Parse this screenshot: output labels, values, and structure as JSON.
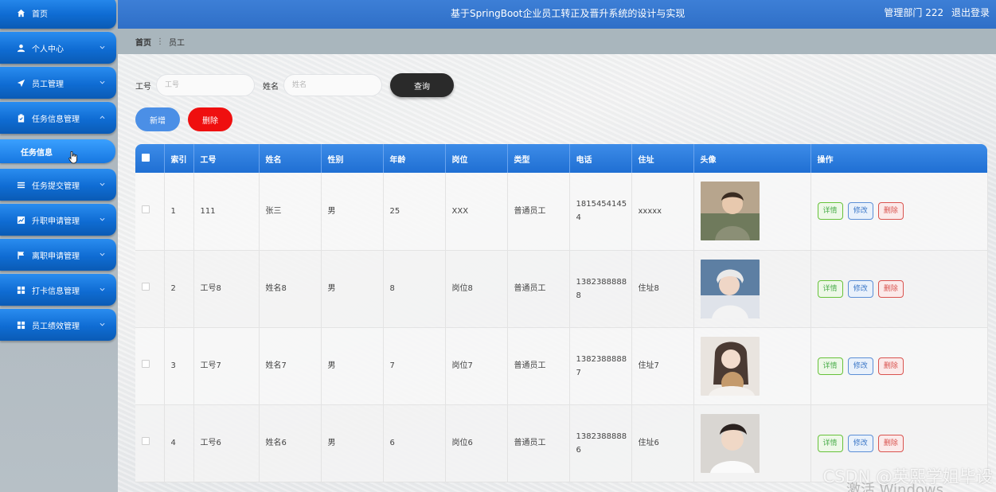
{
  "header": {
    "title": "基于SpringBoot企业员工转正及晋升系统的设计与实现",
    "user_label": "管理部门 222",
    "logout": "退出登录"
  },
  "sidebar": {
    "items": [
      {
        "label": "首页",
        "icon": "home-icon"
      },
      {
        "label": "个人中心",
        "icon": "user-icon"
      },
      {
        "label": "员工管理",
        "icon": "send-icon"
      },
      {
        "label": "任务信息管理",
        "icon": "clipboard-icon"
      },
      {
        "label": "任务提交管理",
        "icon": "list-icon"
      },
      {
        "label": "升职申请管理",
        "icon": "chart-icon"
      },
      {
        "label": "离职申请管理",
        "icon": "flag-icon"
      },
      {
        "label": "打卡信息管理",
        "icon": "grid-icon"
      },
      {
        "label": "员工绩效管理",
        "icon": "grid-icon"
      }
    ],
    "sub_item": "任务信息"
  },
  "breadcrumb": {
    "home": "首页",
    "current": "员工"
  },
  "search": {
    "id_label": "工号",
    "id_placeholder": "工号",
    "name_label": "姓名",
    "name_placeholder": "姓名",
    "query_button": "查询"
  },
  "actions": {
    "add": "新增",
    "delete": "删除"
  },
  "table": {
    "columns": [
      "索引",
      "工号",
      "姓名",
      "性别",
      "年龄",
      "岗位",
      "类型",
      "电话",
      "住址",
      "头像",
      "操作"
    ],
    "rows": [
      {
        "index": "1",
        "id": "111",
        "name": "张三",
        "gender": "男",
        "age": "25",
        "post": "XXX",
        "type": "普通员工",
        "phone": "18154541454",
        "address": "xxxxx"
      },
      {
        "index": "2",
        "id": "工号8",
        "name": "姓名8",
        "gender": "男",
        "age": "8",
        "post": "岗位8",
        "type": "普通员工",
        "phone": "13823888888",
        "address": "住址8"
      },
      {
        "index": "3",
        "id": "工号7",
        "name": "姓名7",
        "gender": "男",
        "age": "7",
        "post": "岗位7",
        "type": "普通员工",
        "phone": "13823888887",
        "address": "住址7"
      },
      {
        "index": "4",
        "id": "工号6",
        "name": "姓名6",
        "gender": "男",
        "age": "6",
        "post": "岗位6",
        "type": "普通员工",
        "phone": "13823888886",
        "address": "住址6"
      }
    ],
    "ops": {
      "detail": "详情",
      "edit": "修改",
      "remove": "删除"
    }
  },
  "watermark": "CSDN @英熙学姐毕设",
  "os_watermark": "激活 Windows",
  "colors": {
    "header": "#2f6fc7",
    "sidebar_item": "#0f6cd3",
    "delete": "#ef0f0f",
    "query": "#2a2a2a"
  }
}
